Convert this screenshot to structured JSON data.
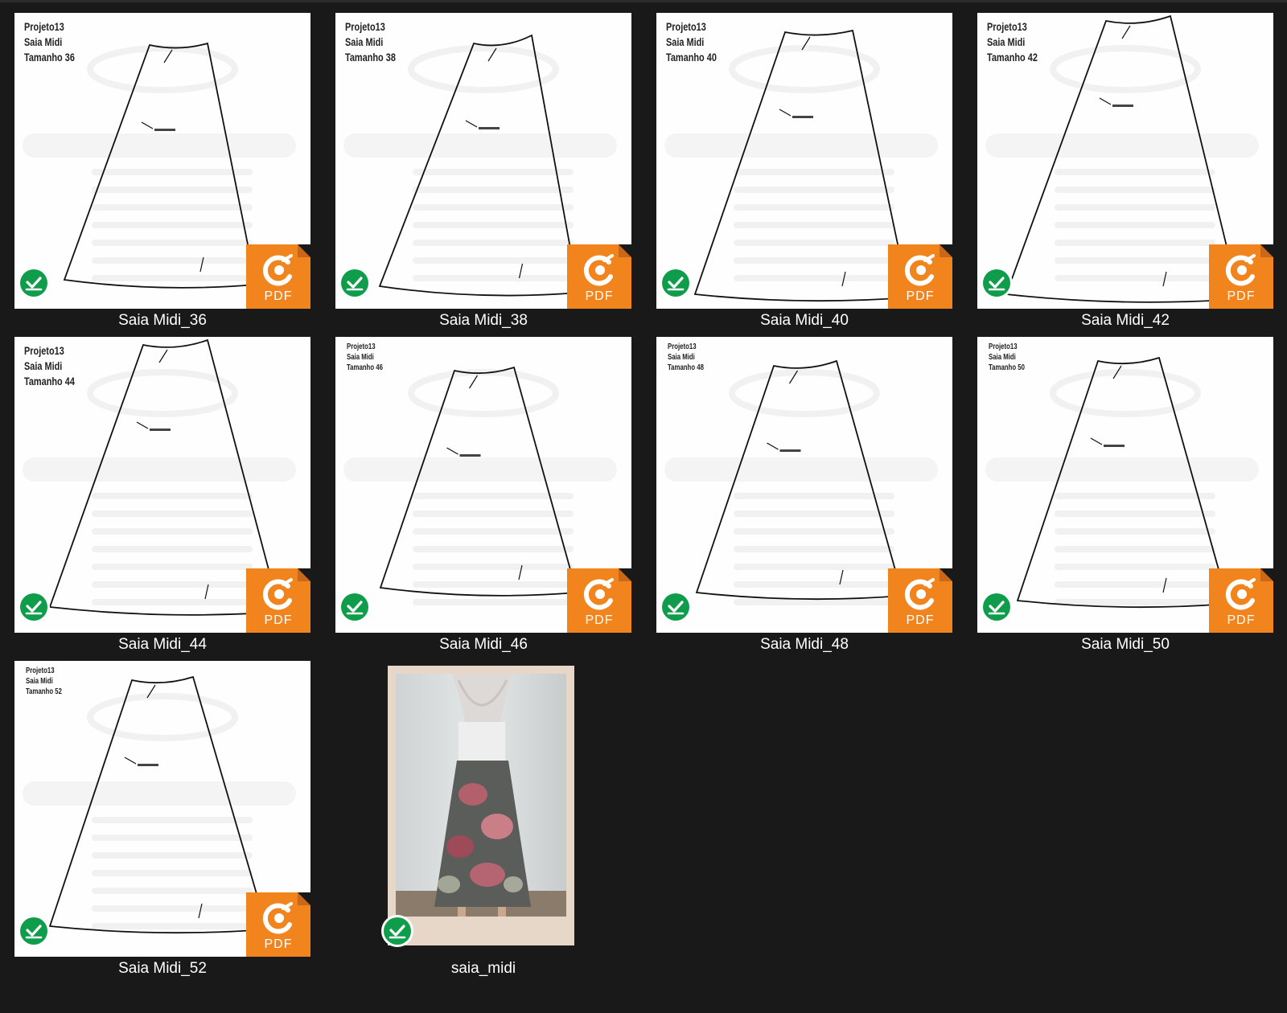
{
  "files": [
    {
      "name": "Saia Midi_36",
      "header": [
        "Projeto13",
        "Saia Midi",
        "Tamanho 36"
      ],
      "status_icon": "check-circle-icon",
      "file_icon": "pdf-icon",
      "pdf_label": "PDF"
    },
    {
      "name": "Saia Midi_38",
      "header": [
        "Projeto13",
        "Saia Midi",
        "Tamanho 38"
      ],
      "status_icon": "check-circle-icon",
      "file_icon": "pdf-icon",
      "pdf_label": "PDF"
    },
    {
      "name": "Saia Midi_40",
      "header": [
        "Projeto13",
        "Saia Midi",
        "Tamanho 40"
      ],
      "status_icon": "check-circle-icon",
      "file_icon": "pdf-icon",
      "pdf_label": "PDF"
    },
    {
      "name": "Saia Midi_42",
      "header": [
        "Projeto13",
        "Saia Midi",
        "Tamanho 42"
      ],
      "status_icon": "check-circle-icon",
      "file_icon": "pdf-icon",
      "pdf_label": "PDF"
    },
    {
      "name": "Saia Midi_44",
      "header": [
        "Projeto13",
        "Saia Midi",
        "Tamanho 44"
      ],
      "status_icon": "check-circle-icon",
      "file_icon": "pdf-icon",
      "pdf_label": "PDF"
    },
    {
      "name": "Saia Midi_46",
      "header": [
        "Projeto13",
        "Saia Midi",
        "Tamanho 46"
      ],
      "status_icon": "check-circle-icon",
      "file_icon": "pdf-icon",
      "pdf_label": "PDF"
    },
    {
      "name": "Saia Midi_48",
      "header": [
        "Projeto13",
        "Saia Midi",
        "Tamanho 48"
      ],
      "status_icon": "check-circle-icon",
      "file_icon": "pdf-icon",
      "pdf_label": "PDF"
    },
    {
      "name": "Saia Midi_50",
      "header": [
        "Projeto13",
        "Saia Midi",
        "Tamanho 50"
      ],
      "status_icon": "check-circle-icon",
      "file_icon": "pdf-icon",
      "pdf_label": "PDF"
    },
    {
      "name": "Saia Midi_52",
      "header": [
        "Projeto13",
        "Saia Midi",
        "Tamanho 52"
      ],
      "status_icon": "check-circle-icon",
      "file_icon": "pdf-icon",
      "pdf_label": "PDF"
    }
  ],
  "image_file": {
    "name": "saia_midi",
    "status_icon": "check-circle-icon",
    "file_icon": "image-thumbnail"
  },
  "colors": {
    "background": "#191919",
    "pdf_orange": "#f2841d",
    "sync_green": "#0f9d4c",
    "label": "#ffffff"
  }
}
